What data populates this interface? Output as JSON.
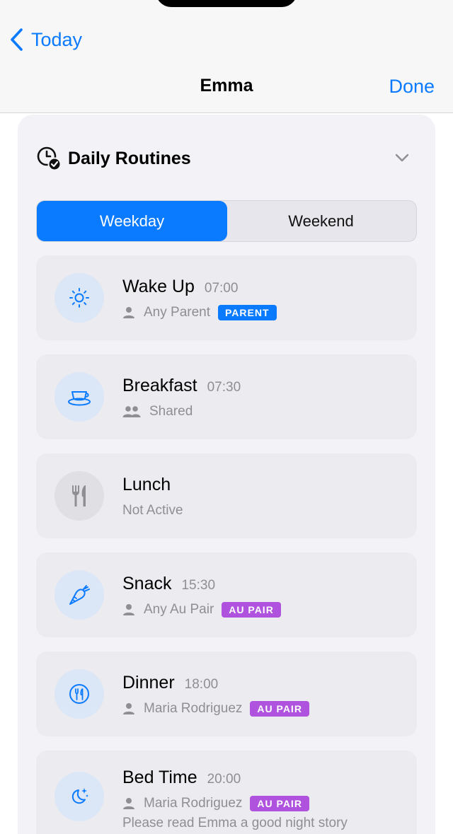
{
  "nav": {
    "back_label": "Today",
    "title": "Emma",
    "done_label": "Done"
  },
  "section": {
    "title": "Daily Routines",
    "icon": "clock-check-icon"
  },
  "segments": {
    "options": [
      "Weekday",
      "Weekend"
    ],
    "selected": "Weekday"
  },
  "routines": [
    {
      "name": "Wake Up",
      "time": "07:00",
      "assignee": "Any Parent",
      "badge": "PARENT",
      "icon": "sun-icon",
      "active": true
    },
    {
      "name": "Breakfast",
      "time": "07:30",
      "assignee": "Shared",
      "badge": "",
      "icon": "cup-icon",
      "active": true
    },
    {
      "name": "Lunch",
      "time": "",
      "assignee": "Not Active",
      "badge": "",
      "icon": "fork-knife-icon",
      "active": false
    },
    {
      "name": "Snack",
      "time": "15:30",
      "assignee": "Any Au Pair",
      "badge": "AU PAIR",
      "icon": "carrot-icon",
      "active": true
    },
    {
      "name": "Dinner",
      "time": "18:00",
      "assignee": "Maria Rodriguez",
      "badge": "AU PAIR",
      "icon": "fork-knife-circle-icon",
      "active": true
    },
    {
      "name": "Bed Time",
      "time": "20:00",
      "assignee": "Maria Rodriguez",
      "badge": "AU PAIR",
      "note": "Please read Emma a good night story",
      "icon": "moon-stars-icon",
      "active": true
    }
  ],
  "colors": {
    "accent": "#0a7aff",
    "parent_badge": "#0a7aff",
    "aupair_badge": "#af52de",
    "secondary_text": "#8e8e93"
  }
}
